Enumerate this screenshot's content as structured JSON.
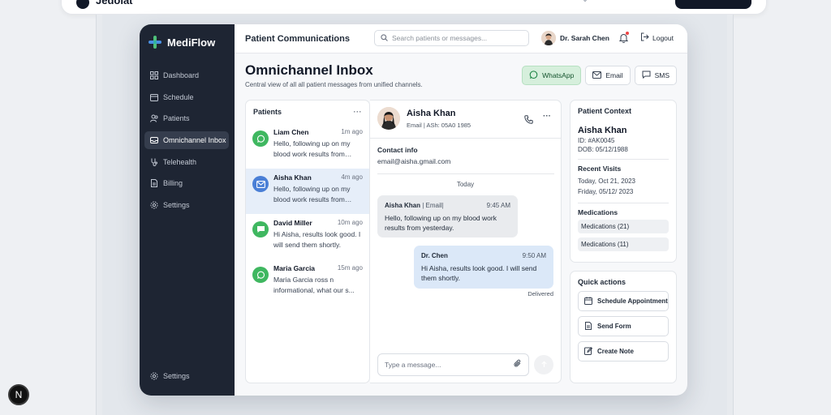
{
  "outer": {
    "title": "Jedolat"
  },
  "next_badge": "N",
  "app": {
    "brand": "MediFlow",
    "nav": [
      {
        "label": "Dashboard",
        "icon": "grid-icon"
      },
      {
        "label": "Schedule",
        "icon": "calendar-icon"
      },
      {
        "label": "Patients",
        "icon": "users-icon"
      },
      {
        "label": "Omnichannel Inbox",
        "icon": "inbox-icon",
        "active": true
      },
      {
        "label": "Telehealth",
        "icon": "stethoscope-icon"
      },
      {
        "label": "Billing",
        "icon": "document-icon"
      },
      {
        "label": "Settings",
        "icon": "gear-icon"
      }
    ],
    "nav_bottom": {
      "label": "Settings",
      "icon": "gear-icon"
    },
    "topbar": {
      "title": "Patient Communications",
      "search_placeholder": "Search patients or messages...",
      "user": "Dr. Sarah Chen",
      "logout": "Logout"
    },
    "page": {
      "title": "Omnichannel Inbox",
      "subtitle": "Central view of all all patient messages from unified channels."
    },
    "channels": [
      {
        "label": "WhatsApp",
        "active": true
      },
      {
        "label": "Email",
        "active": false
      },
      {
        "label": "SMS",
        "active": false
      }
    ],
    "patients": {
      "title": "Patients",
      "more": "···",
      "items": [
        {
          "name": "Liam Chen",
          "time": "1m ago",
          "message": "Hello, following up on my blood work results from yesterday.",
          "channel": "whatsapp",
          "color": "#3fb760"
        },
        {
          "name": "Aisha Khan",
          "time": "4m ago",
          "message": "Hello, following up on my blood work results from yesterday.",
          "channel": "email",
          "color": "#4a7fd6"
        },
        {
          "name": "David Miller",
          "time": "10m ago",
          "message": "Hi Aisha, results look good. I will send them shortly.",
          "channel": "sms",
          "color": "#3fb760"
        },
        {
          "name": "Maria Garcia",
          "time": "15m ago",
          "message": "Maria Garcia ross n informational, what our s...",
          "channel": "whatsapp",
          "color": "#3fb760"
        }
      ]
    },
    "chat": {
      "name": "Aisha Khan",
      "meta": "Email | ASh: 05A0 1985",
      "more": "···",
      "contact_label": "Contact info",
      "contact_value": "email@aisha.gmail.com",
      "date_sep": "Today",
      "messages": [
        {
          "sender": "Aisha Khan",
          "tag": "| Email|",
          "time": "9:45 AM",
          "text": "Hello, following up on my blood work results from yesterday."
        },
        {
          "sender": "Dr. Chen",
          "tag": "",
          "time": "9:50 AM",
          "text": "Hi Aisha, results look good. I will send them shortly."
        }
      ],
      "status": "Delivered",
      "compose_placeholder": "Type a message..."
    },
    "context": {
      "title": "Patient Context",
      "name": "Aisha Khan",
      "id": "ID: #AK0045",
      "dob": "DOB: 05/12/1988",
      "recent_label": "Recent Visits",
      "visits": [
        "Today, Oct 21, 2023",
        "Friday, 05/12/ 2023"
      ],
      "meds_label": "Medications",
      "meds": [
        "Medications (21)",
        "Medications (11)"
      ]
    },
    "quick": {
      "title": "Quick actions",
      "actions": [
        {
          "label": "Schedule Appointment",
          "icon": "calendar-icon"
        },
        {
          "label": "Send Form",
          "icon": "document-icon"
        },
        {
          "label": "Create Note",
          "icon": "edit-icon"
        }
      ]
    }
  }
}
